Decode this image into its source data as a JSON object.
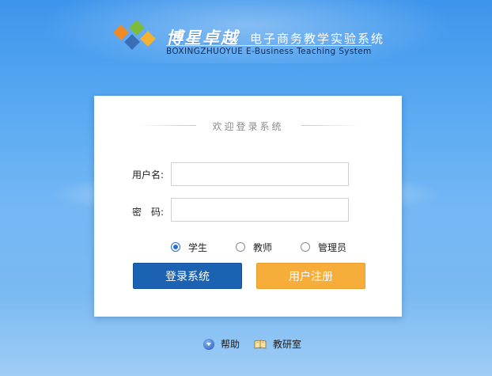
{
  "brand": {
    "name_cn": "博星卓越",
    "subtitle_cn": "电子商务教学实验系统",
    "name_en": "BOXINGZHUOYUE E-Business Teaching System",
    "logo_colors": [
      "#f08a24",
      "#7dbb3a",
      "#3a6fb8",
      "#f4b133"
    ]
  },
  "login": {
    "welcome": "欢迎登录系统",
    "username_label": "用户名:",
    "username_value": "",
    "password_label": "密　码:",
    "password_value": "",
    "roles": [
      {
        "label": "学生",
        "selected": true
      },
      {
        "label": "教师",
        "selected": false
      },
      {
        "label": "管理员",
        "selected": false
      }
    ],
    "login_button": "登录系统",
    "register_button": "用户注册",
    "login_color": "#1c62b3",
    "register_color": "#f6ad3a"
  },
  "footer": {
    "help": "帮助",
    "lab": "教研室",
    "help_icon": "help-circle-icon",
    "lab_icon": "open-book-icon"
  }
}
